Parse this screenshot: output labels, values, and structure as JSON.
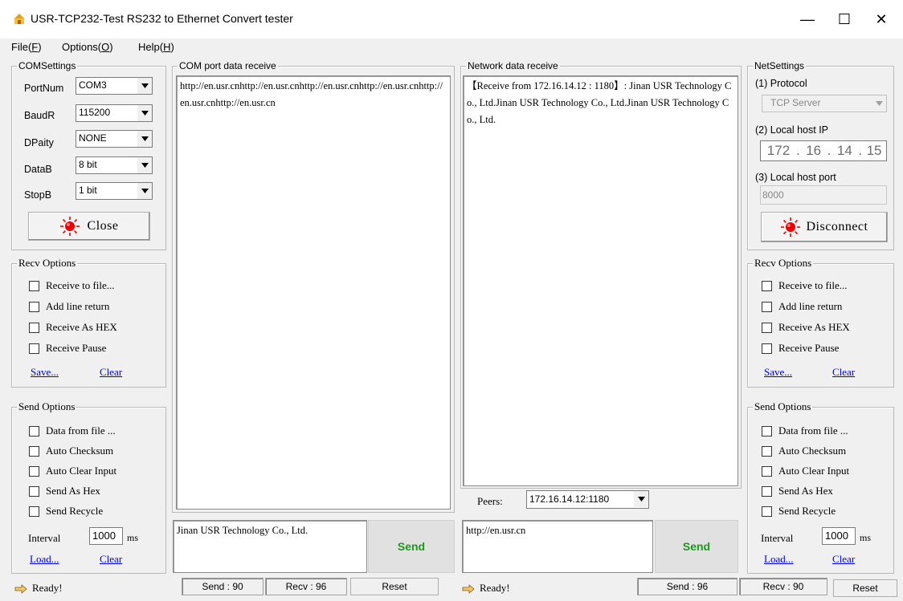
{
  "window": {
    "title": "USR-TCP232-Test  RS232 to Ethernet Convert tester",
    "min": "—",
    "max": "☐",
    "close": "✕"
  },
  "menu": [
    {
      "label": "File(",
      "key": "F",
      "end": ")"
    },
    {
      "label": "Options(",
      "key": "O",
      "end": ")"
    },
    {
      "label": "Help(",
      "key": "H",
      "end": ")"
    }
  ],
  "com_settings": {
    "title": "COMSettings",
    "fields": [
      {
        "label": "PortNum",
        "value": "COM3"
      },
      {
        "label": "BaudR",
        "value": "115200"
      },
      {
        "label": "DPaity",
        "value": "NONE"
      },
      {
        "label": "DataB",
        "value": "8 bit"
      },
      {
        "label": "StopB",
        "value": "1 bit"
      }
    ],
    "button": "Close"
  },
  "com_receive": {
    "title": "COM port data receive",
    "text": "http://en.usr.cnhttp://en.usr.cnhttp://en.usr.cnhttp://en.usr.cnhttp://en.usr.cnhttp://en.usr.cn"
  },
  "net_receive": {
    "title": "Network data receive",
    "text": "【Receive from 172.16.14.12 : 1180】: Jinan USR Technology Co., Ltd.Jinan USR Technology Co., Ltd.Jinan USR Technology Co., Ltd."
  },
  "net_settings": {
    "title": "NetSettings",
    "protocol_label": "(1) Protocol",
    "protocol_value": "TCP Server",
    "ip_label": "(2) Local host IP",
    "ip_parts": [
      "172",
      "16",
      "14",
      "15"
    ],
    "port_label": "(3) Local host port",
    "port_value": "8000",
    "button": "Disconnect"
  },
  "recv_options": {
    "title": "Recv Options",
    "items": [
      "Receive to file...",
      "Add line return",
      "Receive As HEX",
      "Receive Pause"
    ],
    "save": "Save...",
    "clear": "Clear"
  },
  "send_options": {
    "title": "Send Options",
    "items": [
      "Data from file ...",
      "Auto Checksum",
      "Auto Clear Input",
      "Send As Hex",
      "Send Recycle"
    ],
    "interval_label": "Interval",
    "interval_value": "1000",
    "interval_unit": "ms",
    "load": "Load...",
    "clear": "Clear"
  },
  "peers": {
    "label": "Peers:",
    "value": "172.16.14.12:1180"
  },
  "com_send": {
    "text": "Jinan USR Technology Co., Ltd.",
    "button": "Send"
  },
  "net_send": {
    "text": "http://en.usr.cn",
    "button": "Send"
  },
  "status_left": {
    "ready": "Ready!",
    "send": "Send : 90",
    "recv": "Recv : 96",
    "reset": "Reset"
  },
  "status_right": {
    "ready": "Ready!",
    "send": "Send : 96",
    "recv": "Recv : 90",
    "reset": "Reset"
  }
}
